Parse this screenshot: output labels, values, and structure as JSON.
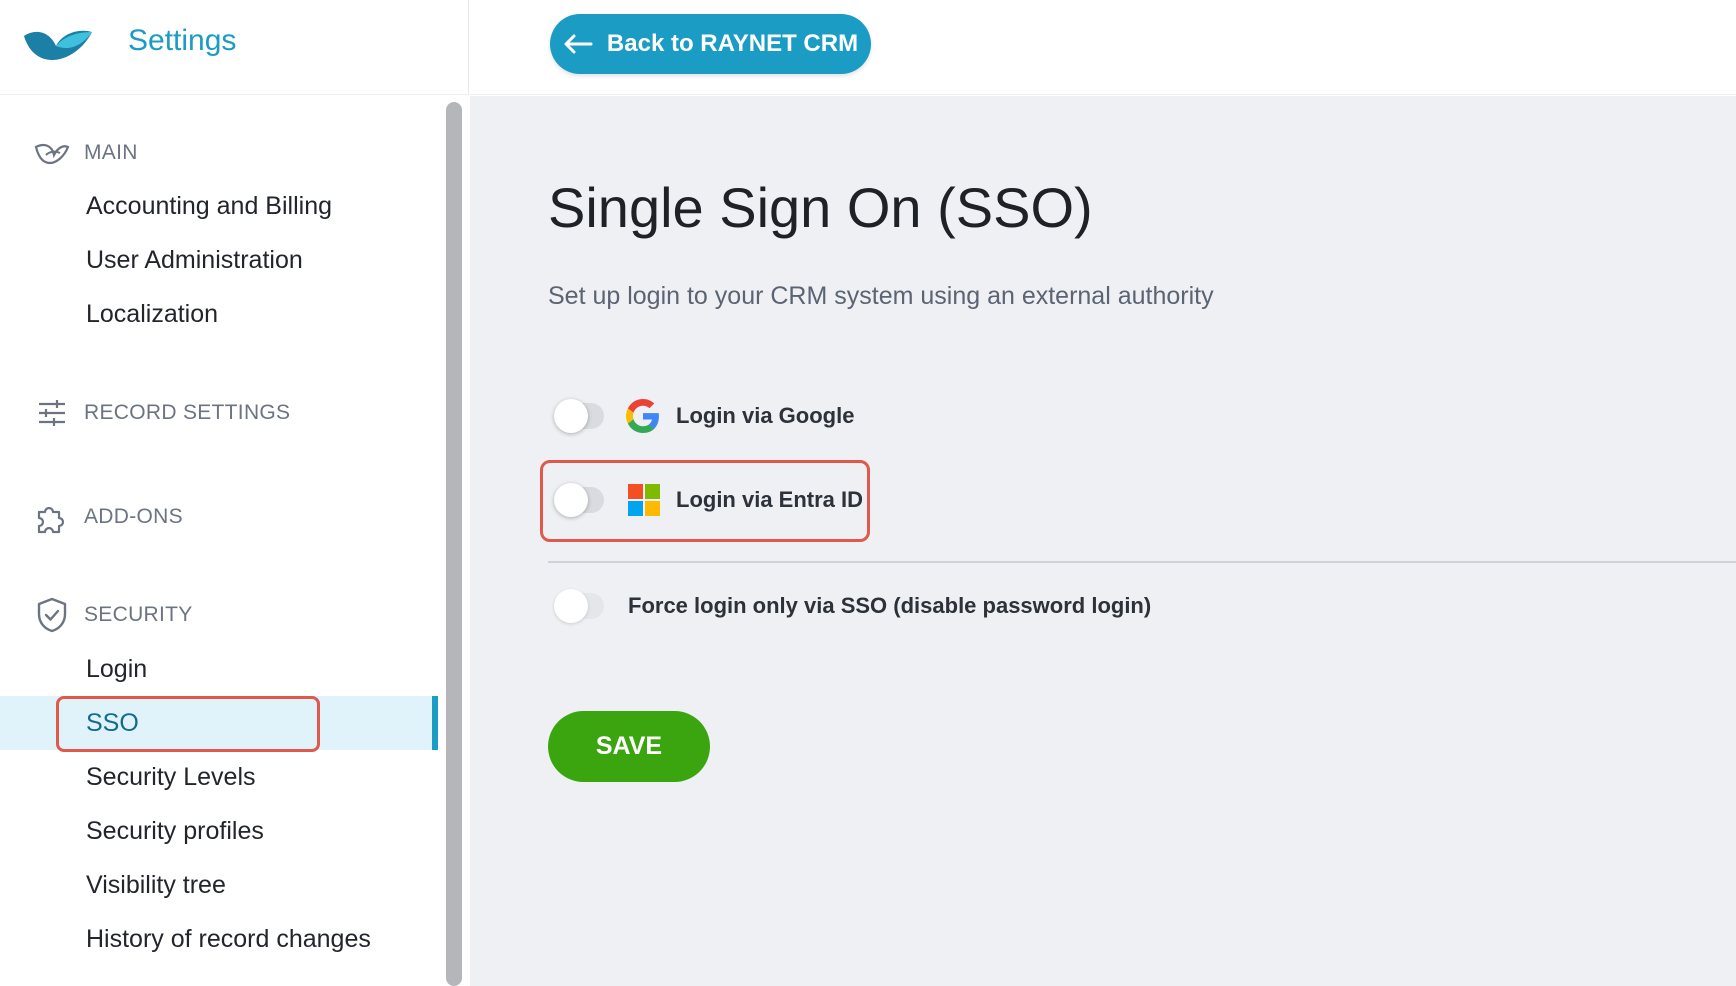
{
  "app": {
    "title": "Settings"
  },
  "topbar": {
    "back_label": "Back to RAYNET CRM"
  },
  "sidebar": {
    "sections": [
      {
        "label": "MAIN",
        "icon": "fish-icon",
        "items": [
          "Accounting and Billing",
          "User Administration",
          "Localization"
        ]
      },
      {
        "label": "RECORD SETTINGS",
        "icon": "sliders-icon",
        "items": []
      },
      {
        "label": "ADD-ONS",
        "icon": "puzzle-icon",
        "items": []
      },
      {
        "label": "SECURITY",
        "icon": "shield-check-icon",
        "items": [
          "Login",
          "SSO",
          "Security Levels",
          "Security profiles",
          "Visibility tree",
          "History of record changes"
        ]
      }
    ],
    "active_item": "SSO"
  },
  "page": {
    "title": "Single Sign On (SSO)",
    "subtitle": "Set up login to your CRM system using an external authority"
  },
  "options": [
    {
      "label": "Login via Google",
      "icon": "google-icon",
      "enabled": false
    },
    {
      "label": "Login via Entra ID",
      "icon": "microsoft-icon",
      "enabled": false
    },
    {
      "label": "Force login only via SSO (disable password login)",
      "enabled": false
    }
  ],
  "actions": {
    "save_label": "SAVE"
  },
  "colors": {
    "brand": "#1b9cc4",
    "save": "#3aa50f",
    "highlight": "#e0594a",
    "background": "#eff0f4"
  }
}
